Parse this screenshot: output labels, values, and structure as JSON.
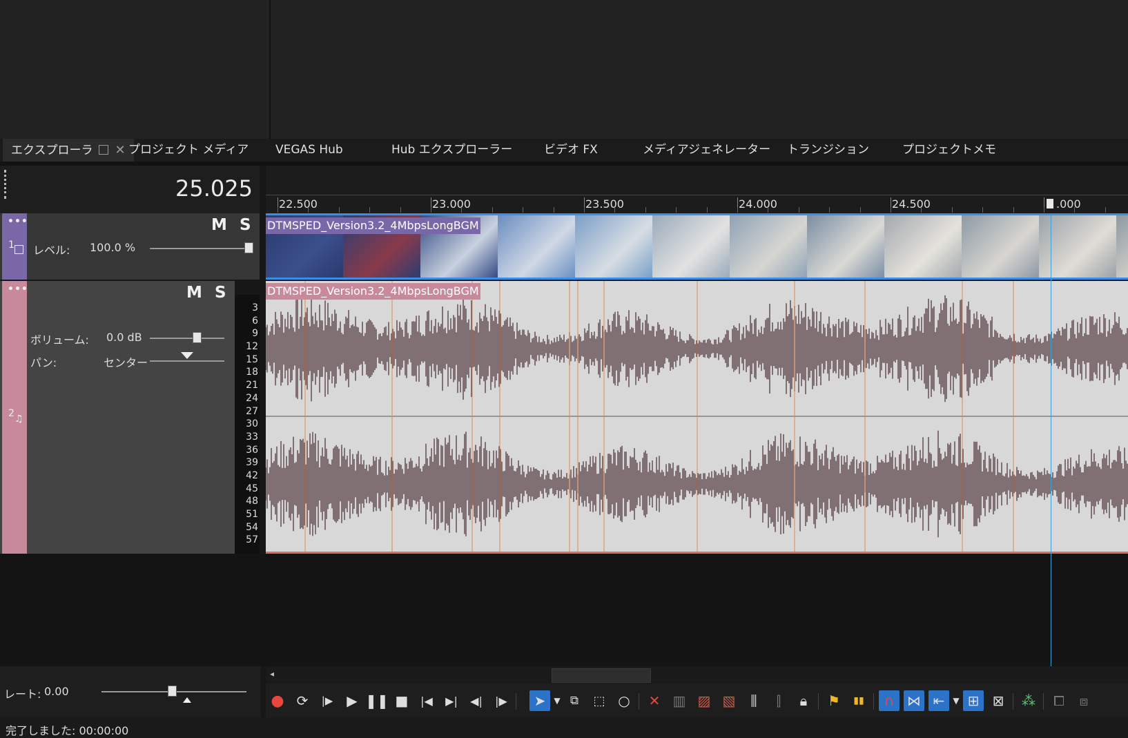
{
  "tabs": {
    "explorer": "エクスプローラ",
    "project_media": "プロジェクト メディア",
    "vegas_hub": "VEGAS Hub",
    "hub_explorer": "Hub エクスプローラー",
    "video_fx": "ビデオ FX",
    "media_generator": "メディアジェネレーター",
    "transition": "トランジション",
    "project_memo": "プロジェクトメモ"
  },
  "timecode": "25.025",
  "ruler": {
    "labels": [
      "22.500",
      "23.000",
      "23.500",
      "24.000",
      "24.500",
      ".000"
    ]
  },
  "video_track": {
    "number": "1",
    "mute": "M",
    "solo": "S",
    "level_label": "レベル:",
    "level_value": "100.0 %",
    "level_fraction": 1.0,
    "clip_name": "DTMSPED_Version3.2_4MbpsLongBGM"
  },
  "audio_track": {
    "number": "2",
    "mute": "M",
    "solo": "S",
    "volume_label": "ボリューム:",
    "volume_value": "0.0 dB",
    "pan_label": "パン:",
    "pan_value": "センター",
    "clip_name": "DTMSPED_Version3.2_4MbpsLongBGM",
    "meter_scale": [
      "3",
      "6",
      "9",
      "12",
      "15",
      "18",
      "21",
      "24",
      "27",
      "30",
      "33",
      "36",
      "39",
      "42",
      "45",
      "48",
      "51",
      "54",
      "57"
    ]
  },
  "rate": {
    "label": "レート:",
    "value": "0.00"
  },
  "status": {
    "text": "完了しました: 00:00:00"
  },
  "colors": {
    "video_track": "#7a67a8",
    "audio_track": "#c88a9a",
    "waveform": "#5b4448",
    "accent": "#2a73c8",
    "record": "#e8473e"
  }
}
